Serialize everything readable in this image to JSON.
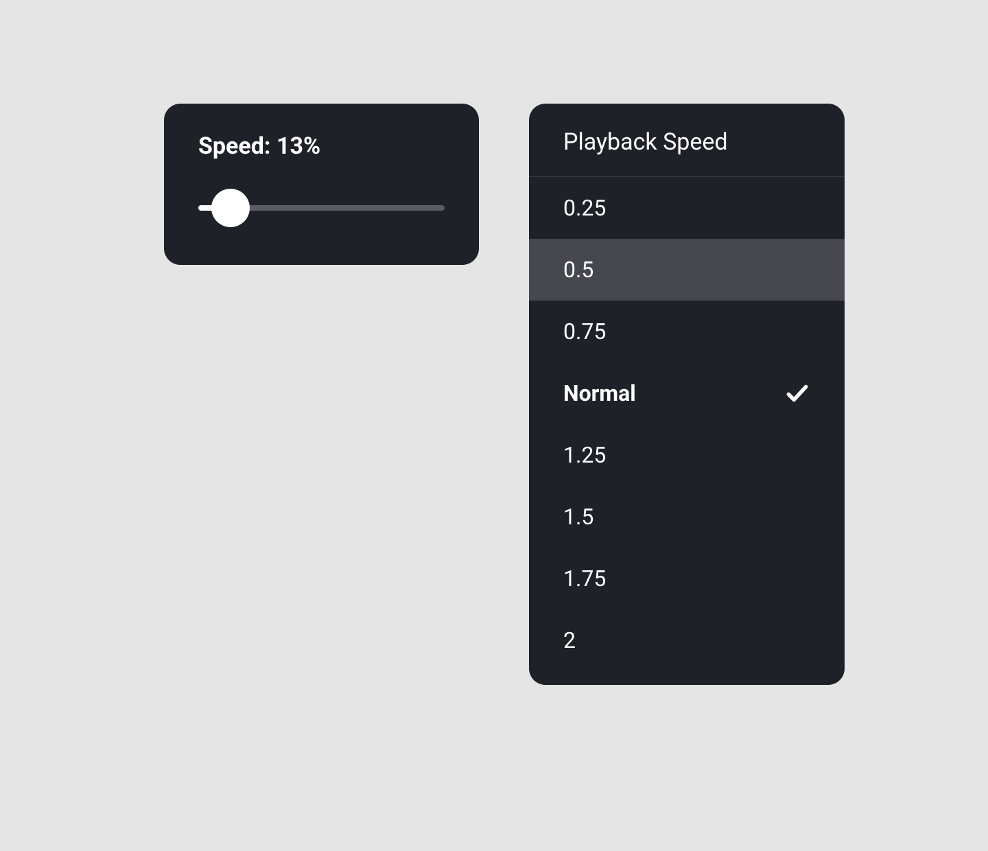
{
  "speed_slider": {
    "label": "Speed: 13%",
    "value_percent": 13
  },
  "playback_menu": {
    "title": "Playback Speed",
    "items": [
      {
        "label": "0.25",
        "selected": false,
        "hovered": false
      },
      {
        "label": "0.5",
        "selected": false,
        "hovered": true
      },
      {
        "label": "0.75",
        "selected": false,
        "hovered": false
      },
      {
        "label": "Normal",
        "selected": true,
        "hovered": false
      },
      {
        "label": "1.25",
        "selected": false,
        "hovered": false
      },
      {
        "label": "1.5",
        "selected": false,
        "hovered": false
      },
      {
        "label": "1.75",
        "selected": false,
        "hovered": false
      },
      {
        "label": "2",
        "selected": false,
        "hovered": false
      }
    ]
  }
}
